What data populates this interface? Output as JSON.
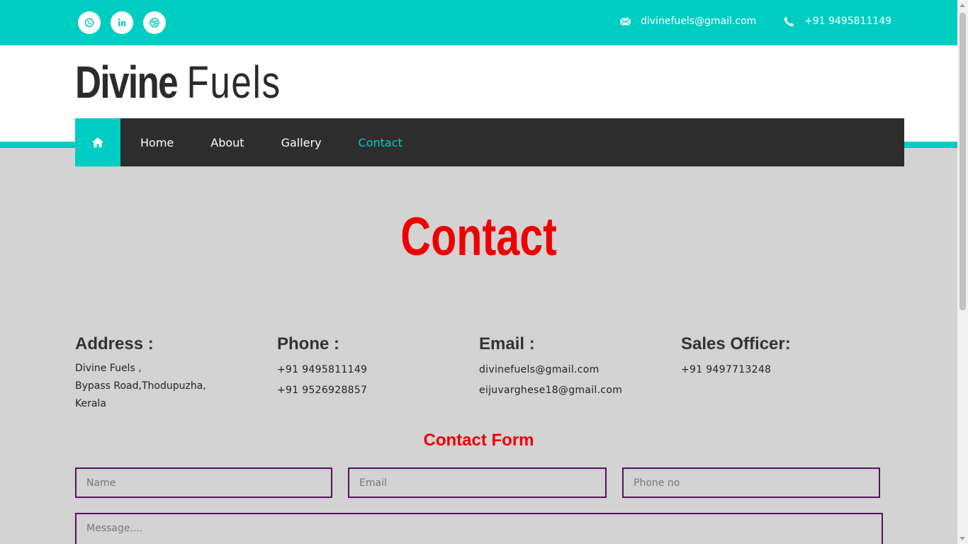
{
  "topbar": {
    "social": [
      {
        "icon": "whatsapp-icon"
      },
      {
        "icon": "linkedin-icon"
      },
      {
        "icon": "dribbble-icon"
      }
    ],
    "email": "divinefuels@gmail.com",
    "phone": "+91 9495811149",
    "accent_color": "#00cdc2"
  },
  "header": {
    "logo_bold": "Divine",
    "logo_light": "Fuels"
  },
  "nav": {
    "home_icon": "home-icon",
    "items": [
      {
        "label": "Home"
      },
      {
        "label": "About"
      },
      {
        "label": "Gallery"
      },
      {
        "label": "Contact",
        "active": true
      }
    ]
  },
  "main": {
    "title": "Contact",
    "title_color": "#ee0000",
    "address": {
      "heading": "Address :",
      "lines": [
        "Divine Fuels ,",
        "Bypass Road,Thodupuzha,",
        "Kerala"
      ]
    },
    "phone": {
      "heading": "Phone :",
      "lines": [
        "+91 9495811149",
        "+91 9526928857"
      ]
    },
    "email": {
      "heading": "Email :",
      "lines": [
        "divinefuels@gmail.com",
        "eijuvarghese18@gmail.com"
      ]
    },
    "sales": {
      "heading": "Sales Officer:",
      "lines": [
        "+91 9497713248"
      ]
    },
    "form": {
      "title": "Contact Form",
      "name_placeholder": "Name",
      "email_placeholder": "Email",
      "phone_placeholder": "Phone no",
      "message_placeholder": "Message...."
    }
  }
}
